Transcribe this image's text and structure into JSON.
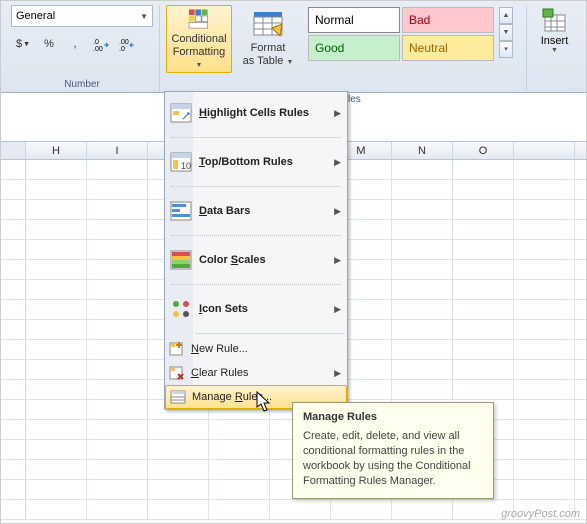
{
  "number_group": {
    "format_selected": "General",
    "label": "Number",
    "currency_glyph": "$",
    "percent_glyph": "%",
    "comma_glyph": ",",
    "dec_inc_glyph": ".0→",
    "dec_dec_glyph": "←.0"
  },
  "styles_group": {
    "cond_fmt_line1": "Conditional",
    "cond_fmt_line2": "Formatting",
    "fmt_table_line1": "Format",
    "fmt_table_line2": "as Table",
    "gallery": {
      "normal": "Normal",
      "bad": "Bad",
      "good": "Good",
      "neutral": "Neutral"
    },
    "label_fragment": "les"
  },
  "cells_group": {
    "insert": "Insert"
  },
  "menu": {
    "items": [
      {
        "label_pre": "",
        "label_ul": "H",
        "label_post": "ighlight Cells Rules",
        "arrow": true,
        "big": true
      },
      {
        "label_pre": "",
        "label_ul": "T",
        "label_post": "op/Bottom Rules",
        "arrow": true,
        "big": true
      },
      {
        "label_pre": "",
        "label_ul": "D",
        "label_post": "ata Bars",
        "arrow": true,
        "big": true
      },
      {
        "label_pre": "Color ",
        "label_ul": "S",
        "label_post": "cales",
        "arrow": true,
        "big": true
      },
      {
        "label_pre": "",
        "label_ul": "I",
        "label_post": "con Sets",
        "arrow": true,
        "big": true
      },
      {
        "label_pre": "",
        "label_ul": "N",
        "label_post": "ew Rule...",
        "arrow": false,
        "big": false
      },
      {
        "label_pre": "",
        "label_ul": "C",
        "label_post": "lear Rules",
        "arrow": true,
        "big": false
      },
      {
        "label_pre": "Manage ",
        "label_ul": "R",
        "label_post": "ules...",
        "arrow": false,
        "big": false,
        "hover": true
      }
    ]
  },
  "columns": [
    "H",
    "I",
    "",
    "",
    "",
    "M",
    "N",
    "O",
    ""
  ],
  "tooltip": {
    "title": "Manage Rules",
    "body": "Create, edit, delete, and view all conditional formatting rules in the workbook by using the Conditional Formatting Rules Manager."
  },
  "watermark": "groovyPost.com"
}
